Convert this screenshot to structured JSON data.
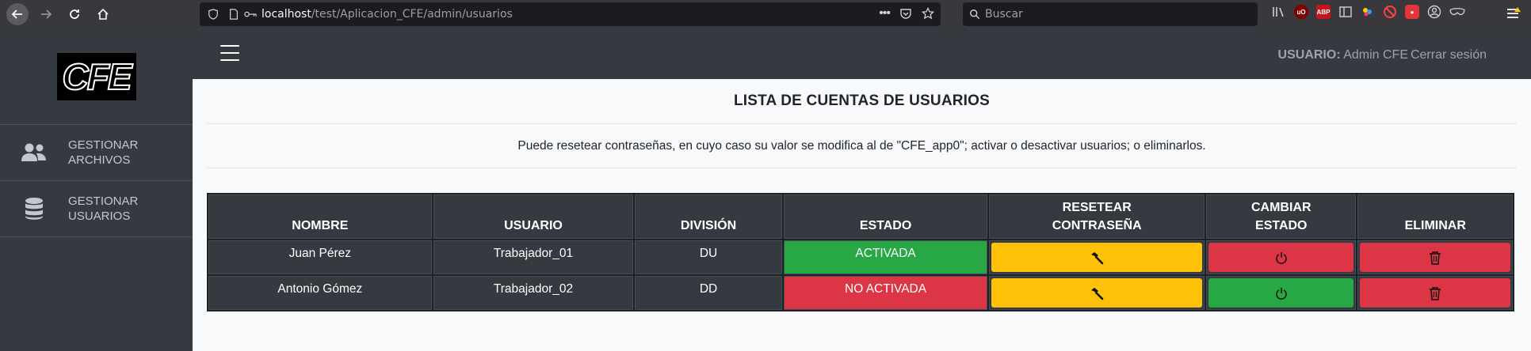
{
  "browser": {
    "url_host": "localhost",
    "url_path": "/test/Aplicacion_CFE/admin/usuarios",
    "search_placeholder": "Buscar",
    "extensions": [
      "uBlock",
      "ABP"
    ]
  },
  "sidebar": {
    "logo_text": "CFE",
    "items": [
      {
        "label": "GESTIONAR ARCHIVOS",
        "icon": "users-icon"
      },
      {
        "label": "GESTIONAR USUARIOS",
        "icon": "database-icon"
      }
    ]
  },
  "topbar": {
    "user_prefix": "USUARIO:",
    "user_name": "Admin CFE",
    "logout_label": "Cerrar sesión"
  },
  "main": {
    "title": "LISTA DE CUENTAS DE USUARIOS",
    "description": "Puede resetear contraseñas, en cuyo caso su valor se modifica al de \"CFE_app0\"; activar o desactivar usuarios; o eliminarlos.",
    "table": {
      "headers": {
        "nombre": "NOMBRE",
        "usuario": "USUARIO",
        "division": "DIVISIÓN",
        "estado": "ESTADO",
        "resetear_1": "RESETEAR",
        "resetear_2": "CONTRASEÑA",
        "cambiar_1": "CAMBIAR",
        "cambiar_2": "ESTADO",
        "eliminar": "ELIMINAR"
      },
      "rows": [
        {
          "nombre": "Juan Pérez",
          "usuario": "Trabajador_01",
          "division": "DU",
          "estado": "ACTIVADA",
          "estado_color": "#28a745",
          "toggle_color": "#dc3545"
        },
        {
          "nombre": "Antonio Gómez",
          "usuario": "Trabajador_02",
          "division": "DD",
          "estado": "NO ACTIVADA",
          "estado_color": "#dc3545",
          "toggle_color": "#28a745"
        }
      ]
    }
  },
  "colors": {
    "dark": "#343a40",
    "success": "#28a745",
    "danger": "#dc3545",
    "warning": "#ffc107"
  }
}
